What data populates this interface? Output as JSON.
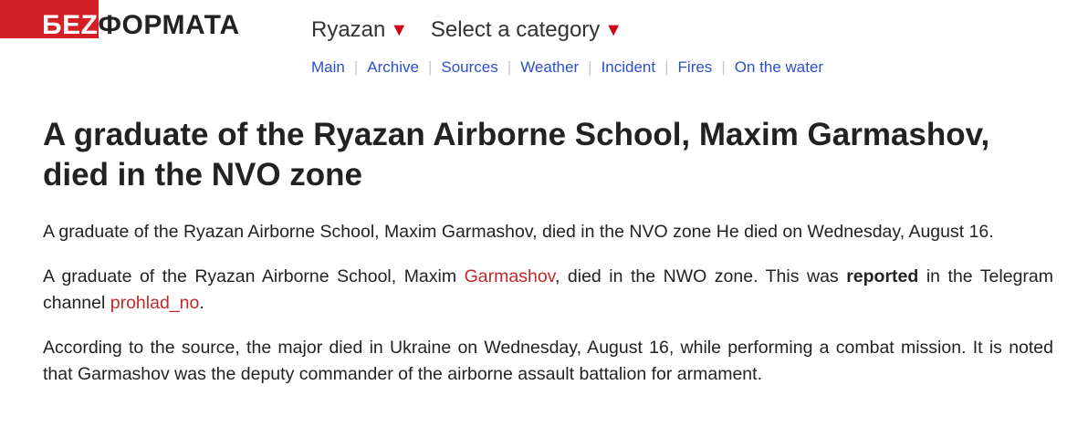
{
  "logo": {
    "part1": "БЕZ",
    "part2": "ФОРМАТА"
  },
  "selectors": {
    "city": "Ryazan",
    "category": "Select a category",
    "caret": "▼"
  },
  "nav": [
    "Main",
    "Archive",
    "Sources",
    "Weather",
    "Incident",
    "Fires",
    "On the water"
  ],
  "nav_separator": "|",
  "article": {
    "title": "A graduate of the Ryazan Airborne School, Maxim Garmashov, died in the NVO zone",
    "summary": "A graduate of the Ryazan Airborne School, Maxim Garmashov, died in the NVO zone He died on Wednesday, August 16.",
    "p2": {
      "before_link": "A graduate of the Ryazan Airborne School, Maxim ",
      "link_name": "Garmashov",
      "after_link": ", died in the NWO zone. This was ",
      "bold_word": "reported",
      "before_channel": " in the Telegram channel ",
      "channel_link": "prohlad_no",
      "end": "."
    },
    "p3": "According to the source, the major died in Ukraine on Wednesday, August 16, while performing a combat mission. It is noted that Garmashov was the deputy commander of the airborne assault battalion for armament."
  },
  "colors": {
    "brand_red": "#d31f26",
    "link_blue": "#2a50c8",
    "link_red": "#c0282d",
    "caret_red": "#d0021b"
  }
}
